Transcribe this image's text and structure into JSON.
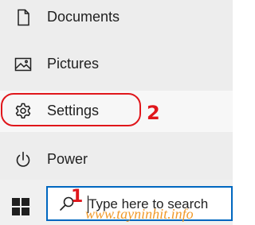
{
  "start_menu": {
    "items": [
      {
        "label": "Documents",
        "icon": "document-icon"
      },
      {
        "label": "Pictures",
        "icon": "pictures-icon"
      },
      {
        "label": "Settings",
        "icon": "gear-icon"
      },
      {
        "label": "Power",
        "icon": "power-icon"
      }
    ]
  },
  "annotations": {
    "step_one": "1",
    "step_two": "2",
    "highlight_color": "#e0161b"
  },
  "taskbar": {
    "start_icon": "windows-logo-icon",
    "search": {
      "icon": "search-icon",
      "placeholder": "Type here to search"
    }
  },
  "watermark": "www.tayninhit.info",
  "colors": {
    "menu_background": "#ededed",
    "search_border": "#0067c0",
    "watermark": "#f19a2a"
  }
}
